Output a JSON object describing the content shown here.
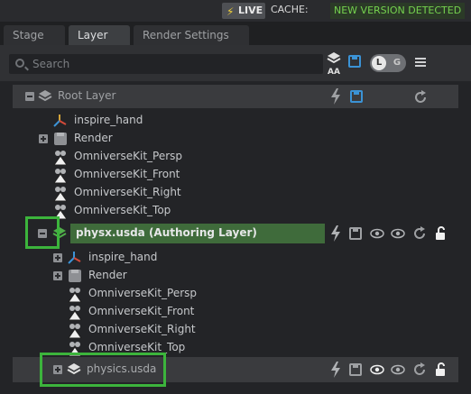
{
  "topbar": {
    "live_label": "LIVE",
    "cache_label": "CACHE:",
    "cache_status": "NEW VERSION DETECTED"
  },
  "tabs": [
    {
      "label": "Stage"
    },
    {
      "label": "Layer"
    },
    {
      "label": "Render Settings"
    }
  ],
  "toolbar": {
    "search_placeholder": "Search",
    "aa_label": "AA",
    "toggle_l": "L",
    "toggle_g": "G"
  },
  "root_layer": {
    "label": "Root Layer",
    "children": [
      {
        "label": "inspire_hand"
      },
      {
        "label": "Render"
      },
      {
        "label": "OmniverseKit_Persp"
      },
      {
        "label": "OmniverseKit_Front"
      },
      {
        "label": "OmniverseKit_Right"
      },
      {
        "label": "OmniverseKit_Top"
      }
    ]
  },
  "authoring_layer": {
    "label": "physx.usda (Authoring Layer)",
    "children": [
      {
        "label": "inspire_hand"
      },
      {
        "label": "Render"
      },
      {
        "label": "OmniverseKit_Persp"
      },
      {
        "label": "OmniverseKit_Front"
      },
      {
        "label": "OmniverseKit_Right"
      },
      {
        "label": "OmniverseKit_Top"
      }
    ]
  },
  "sublayer": {
    "label": "physics.usda"
  },
  "colors": {
    "accent_green": "#3cb43c",
    "live_bolt": "#f2d23a",
    "cache_text": "#75d24f",
    "authoring_bg": "#3f6b3b"
  }
}
